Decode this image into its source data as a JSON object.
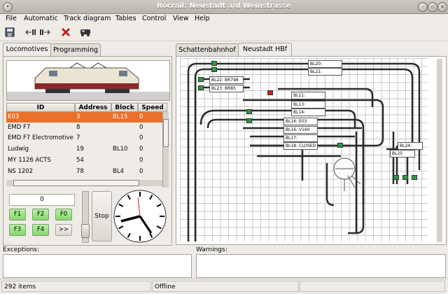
{
  "window": {
    "title": "Rocrail: Neustadt a/d Weinstrasse"
  },
  "menu": [
    "File",
    "Automatic",
    "Track diagram",
    "Tables",
    "Control",
    "View",
    "Help"
  ],
  "toolbar_icons": [
    "save-icon",
    "track-in-icon",
    "track-out-icon",
    "stop-red-x-icon",
    "locomotive-icon"
  ],
  "left_tabs": [
    {
      "label": "Locomotives",
      "active": true
    },
    {
      "label": "Programming",
      "active": false
    }
  ],
  "loco_table": {
    "columns": [
      "ID",
      "Address",
      "Block",
      "Speed"
    ],
    "rows": [
      {
        "id": "E03",
        "address": "3",
        "block": "BL15",
        "speed": "0",
        "selected": true
      },
      {
        "id": "EMD F7",
        "address": "8",
        "block": "",
        "speed": "0"
      },
      {
        "id": "EMD F7 Electromotive",
        "address": "7",
        "block": "",
        "speed": "0"
      },
      {
        "id": "Ludwig",
        "address": "19",
        "block": "BL10",
        "speed": "0"
      },
      {
        "id": "MY 1126 ACTS",
        "address": "54",
        "block": "",
        "speed": "0"
      },
      {
        "id": "NS 1202",
        "address": "78",
        "block": "BL4",
        "speed": "0"
      }
    ]
  },
  "controls": {
    "speed_value": "0",
    "function_buttons": [
      "F1",
      "F2",
      "F0",
      "F3",
      "F4",
      ">>"
    ],
    "stop_label": "Stop"
  },
  "right_tabs": [
    {
      "label": "Schattenbahnhof",
      "active": false
    },
    {
      "label": "Neustadt HBf",
      "active": true
    }
  ],
  "blocks": [
    "BL20:",
    "BL21:",
    "BL22: BR798",
    "BL23: BR85",
    "BL11:",
    "BL13:",
    "BL14:",
    "BL16: E03",
    "BL16: V160",
    "BL17:",
    "BL18: CLOSED",
    "BL24:",
    "BL25"
  ],
  "panels": {
    "exceptions_label": "Exceptions:",
    "warnings_label": "Warnings:"
  },
  "status": {
    "items_count": "292 items",
    "connection": "Offline"
  }
}
